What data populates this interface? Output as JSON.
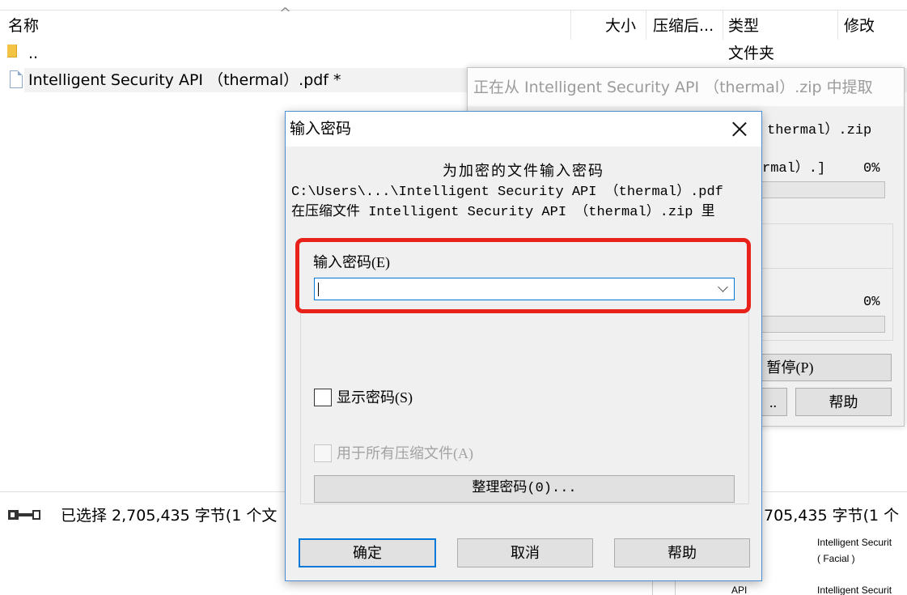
{
  "file_list": {
    "sort_indicator": "^",
    "columns": {
      "name": "名称",
      "size": "大小",
      "packed": "压缩后...",
      "type": "类型",
      "modified": "修改"
    },
    "rows": [
      {
        "icon": "folder-icon",
        "name": "..",
        "type": "文件夹"
      },
      {
        "icon": "pdf-file-icon",
        "name": "Intelligent Security API （thermal）.pdf *",
        "selected": true
      }
    ]
  },
  "extract_window": {
    "title": "正在从 Intelligent Security API （thermal）.zip 中提取",
    "archive_fragment": "thermal）.zip",
    "current_file_fragment": "rmal）.]",
    "file_percent": "0%",
    "file_progress": 0,
    "total_percent": "0%",
    "total_progress": 0,
    "pause_button": "暂停(P)",
    "background_button_fragment": "..",
    "help_button": "帮助"
  },
  "status_bar": {
    "icon": "key-icon",
    "selection_text": "已选择 2,705,435 字节(1 个文",
    "selection_text_right": "705,435 字节(1 个"
  },
  "background_list": {
    "rows": [
      {
        "title": "Intelligent Securit",
        "subtitle": "( Facial )"
      },
      {
        "label": "API",
        "title": "Intelligent Securit"
      }
    ]
  },
  "dialog": {
    "title": "输入密码",
    "close_icon": "close-icon",
    "prompt": "为加密的文件输入密码",
    "file_path": "C:\\Users\\...\\Intelligent Security API （thermal）.pdf",
    "archive_line": "在压缩文件 Intelligent Security API （thermal）.zip 里",
    "password_label": "输入密码(E)",
    "password_value": "",
    "dropdown_icon": "chevron-down-icon",
    "show_password": {
      "label": "显示密码(S)",
      "checked": false
    },
    "use_for_all_archives": {
      "label": "用于所有压缩文件(A)",
      "checked": false,
      "enabled": false
    },
    "organize_button": "整理密码(0)...",
    "ok_button": "确定",
    "cancel_button": "取消",
    "help_button": "帮助"
  },
  "colors": {
    "accent": "#0078d7",
    "highlight": "#e8221b",
    "progress": "#06b025"
  }
}
